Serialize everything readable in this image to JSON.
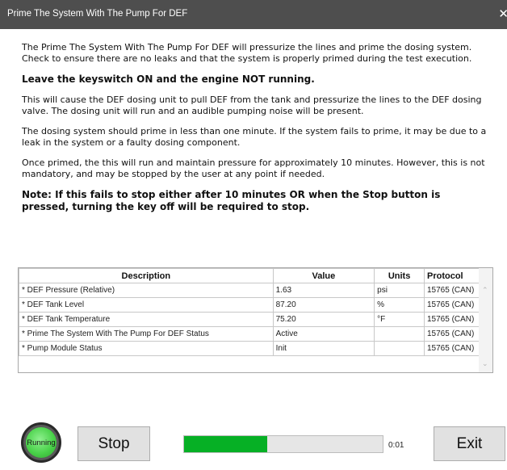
{
  "window": {
    "title": "Prime The System With The Pump For DEF",
    "close_glyph": "✕"
  },
  "instructions": {
    "p1": "The Prime The System With The Pump For DEF will pressurize the lines and prime the dosing system. Check to ensure there are no leaks and that the system is properly primed during the test execution.",
    "p2": "Leave the keyswitch ON and the engine NOT running.",
    "p3": "This will cause the DEF dosing unit to pull DEF from the tank and pressurize the lines to the DEF dosing valve. The dosing unit will run and an audible pumping noise will be present.",
    "p4": "The dosing system should prime in less than one minute. If the system fails to prime, it may be due to a leak in the system or a faulty dosing component.",
    "p5": "Once primed, the this will run and maintain pressure for approximately 10 minutes. However, this is not mandatory, and may be stopped by the user at any point if needed.",
    "p6": "Note: If this fails to stop either after 10 minutes OR when the Stop button is pressed, turning the key off will be required to stop."
  },
  "table": {
    "headers": {
      "description": "Description",
      "value": "Value",
      "units": "Units",
      "protocol": "Protocol"
    },
    "rows": [
      {
        "description": "* DEF Pressure (Relative)",
        "value": "1.63",
        "units": "psi",
        "protocol": "15765 (CAN)"
      },
      {
        "description": "* DEF Tank Level",
        "value": "87.20",
        "units": "%",
        "protocol": "15765 (CAN)"
      },
      {
        "description": "* DEF Tank Temperature",
        "value": "75.20",
        "units": "°F",
        "protocol": "15765 (CAN)"
      },
      {
        "description": "* Prime The System With The Pump For DEF Status",
        "value": "Active",
        "units": "",
        "protocol": "15765 (CAN)"
      },
      {
        "description": "* Pump Module Status",
        "value": "Init",
        "units": "",
        "protocol": "15765 (CAN)"
      }
    ]
  },
  "controls": {
    "status_label": "Running",
    "stop_label": "Stop",
    "exit_label": "Exit",
    "progress_fraction": 0.42,
    "elapsed": "0:01"
  },
  "colors": {
    "titlebar": "#4e4e4e",
    "progress_fill": "#06b025",
    "status_green": "#4ad24a"
  }
}
